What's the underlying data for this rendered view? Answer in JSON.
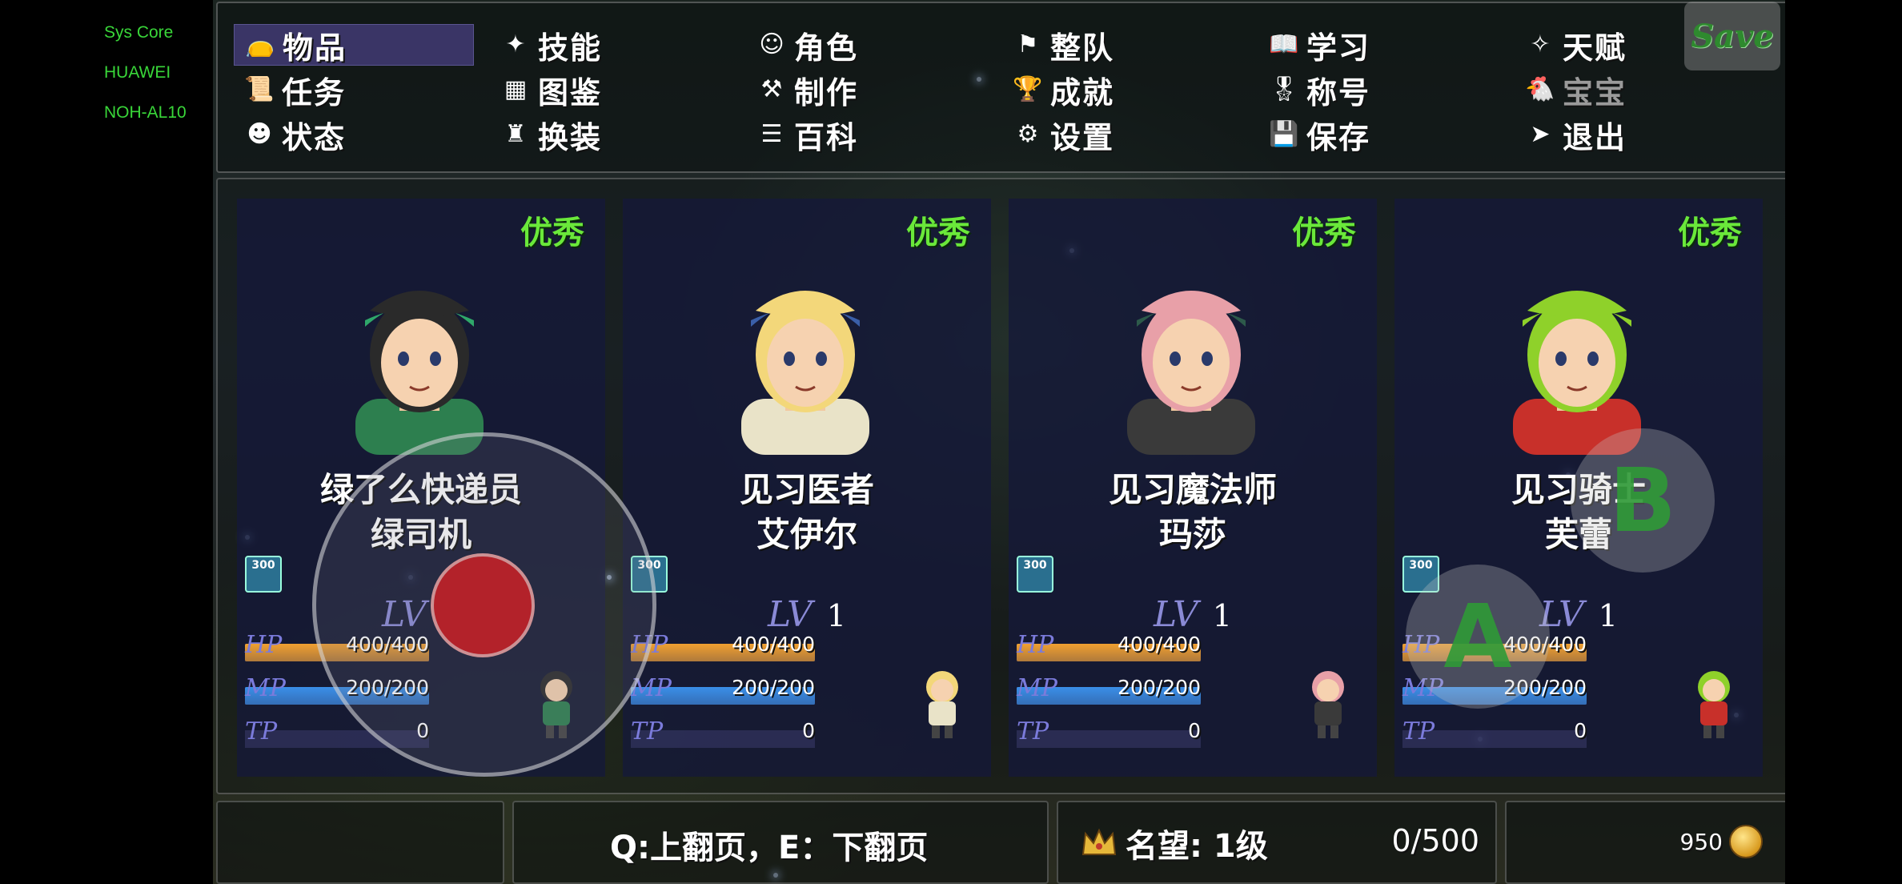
{
  "system": {
    "lines": [
      "Sys Core",
      "HUAWEI",
      "NOH-AL10"
    ]
  },
  "menu": {
    "items": [
      {
        "label": "物品",
        "icon": "bag-icon",
        "active": true
      },
      {
        "label": "技能",
        "icon": "skill-icon"
      },
      {
        "label": "角色",
        "icon": "masks-icon"
      },
      {
        "label": "整队",
        "icon": "flag-icon"
      },
      {
        "label": "学习",
        "icon": "book-icon"
      },
      {
        "label": "天赋",
        "icon": "talent-icon"
      },
      {
        "label": "任务",
        "icon": "scroll-icon"
      },
      {
        "label": "图鉴",
        "icon": "bestiary-icon"
      },
      {
        "label": "制作",
        "icon": "anvil-icon"
      },
      {
        "label": "成就",
        "icon": "trophy-icon"
      },
      {
        "label": "称号",
        "icon": "medal-icon"
      },
      {
        "label": "宝宝",
        "icon": "pet-icon",
        "dim": true
      },
      {
        "label": "状态",
        "icon": "status-icon"
      },
      {
        "label": "换装",
        "icon": "outfit-icon"
      },
      {
        "label": "百科",
        "icon": "encyclopedia-icon"
      },
      {
        "label": "设置",
        "icon": "gear-icon"
      },
      {
        "label": "保存",
        "icon": "floppy-icon"
      },
      {
        "label": "退出",
        "icon": "exit-icon"
      }
    ],
    "save_label": "Save"
  },
  "party": [
    {
      "rank": "优秀",
      "class": "绿了么快递员",
      "name": "绿司机",
      "badge": "300",
      "lv_label": "LV",
      "lv": "1",
      "hp_label": "HP",
      "hp": "400/400",
      "hp_frac": 1.0,
      "mp_label": "MP",
      "mp": "200/200",
      "mp_frac": 1.0,
      "tp_label": "TP",
      "tp": "0",
      "tp_frac": 0.0,
      "hair": "#2a2a2a",
      "hat": "#2fa86a",
      "outfit": "#2d7f4f"
    },
    {
      "rank": "优秀",
      "class": "见习医者",
      "name": "艾伊尔",
      "badge": "300",
      "lv_label": "LV",
      "lv": "1",
      "hp_label": "HP",
      "hp": "400/400",
      "hp_frac": 1.0,
      "mp_label": "MP",
      "mp": "200/200",
      "mp_frac": 1.0,
      "tp_label": "TP",
      "tp": "0",
      "tp_frac": 0.0,
      "hair": "#f3d77a",
      "hat": "#3a5fa8",
      "outfit": "#e9e3c8"
    },
    {
      "rank": "优秀",
      "class": "见习魔法师",
      "name": "玛莎",
      "badge": "300",
      "lv_label": "LV",
      "lv": "1",
      "hp_label": "HP",
      "hp": "400/400",
      "hp_frac": 1.0,
      "mp_label": "MP",
      "mp": "200/200",
      "mp_frac": 1.0,
      "tp_label": "TP",
      "tp": "0",
      "tp_frac": 0.0,
      "hair": "#e8a0a8",
      "hat": "#2d5a4a",
      "outfit": "#3a3a3a"
    },
    {
      "rank": "优秀",
      "class": "见习骑士",
      "name": "芙蕾",
      "badge": "300",
      "lv_label": "LV",
      "lv": "1",
      "hp_label": "HP",
      "hp": "400/400",
      "hp_frac": 1.0,
      "mp_label": "MP",
      "mp": "200/200",
      "mp_frac": 1.0,
      "tp_label": "TP",
      "tp": "0",
      "tp_frac": 0.0,
      "hair": "#8fd12a",
      "hat": "#8fd12a",
      "outfit": "#c8302a"
    }
  ],
  "controls": {
    "a_label": "A",
    "b_label": "B"
  },
  "footer": {
    "hint": "Q:上翻页，E：下翻页",
    "reputation": "名望: 1级",
    "progress": "0/500",
    "gold": "950"
  },
  "colors": {
    "rank": "#6ae83a",
    "hp_bar": "#f0a030",
    "mp_bar": "#3a8fe8",
    "menu_active": "#3a3566"
  }
}
